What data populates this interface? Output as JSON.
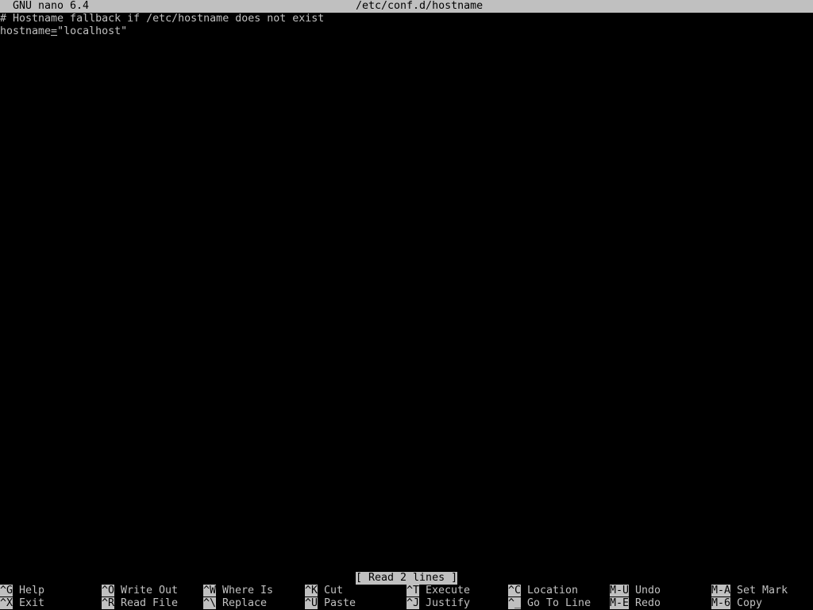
{
  "titlebar": {
    "app": "GNU nano 6.4",
    "filename": "/etc/conf.d/hostname"
  },
  "editor": {
    "lines": [
      "# Hostname fallback if /etc/hostname does not exist",
      "hostname=\"localhost\""
    ],
    "line2_parts": {
      "before": "hostname",
      "cursor": "=",
      "after": "\"localhost\""
    }
  },
  "status": {
    "message": "[ Read 2 lines ]"
  },
  "shortcuts": {
    "row1": [
      {
        "key": "^G",
        "label": "Help"
      },
      {
        "key": "^O",
        "label": "Write Out"
      },
      {
        "key": "^W",
        "label": "Where Is"
      },
      {
        "key": "^K",
        "label": "Cut"
      },
      {
        "key": "^T",
        "label": "Execute"
      },
      {
        "key": "^C",
        "label": "Location"
      },
      {
        "key": "M-U",
        "label": "Undo"
      },
      {
        "key": "M-A",
        "label": "Set Mark"
      }
    ],
    "row2": [
      {
        "key": "^X",
        "label": "Exit"
      },
      {
        "key": "^R",
        "label": "Read File"
      },
      {
        "key": "^\\",
        "label": "Replace"
      },
      {
        "key": "^U",
        "label": "Paste"
      },
      {
        "key": "^J",
        "label": "Justify"
      },
      {
        "key": "^_",
        "label": "Go To Line"
      },
      {
        "key": "M-E",
        "label": "Redo"
      },
      {
        "key": "M-6",
        "label": "Copy"
      }
    ]
  },
  "colors": {
    "background": "#000000",
    "foreground": "#c0c0c0",
    "inverse_bg": "#c0c0c0",
    "inverse_fg": "#000000"
  }
}
